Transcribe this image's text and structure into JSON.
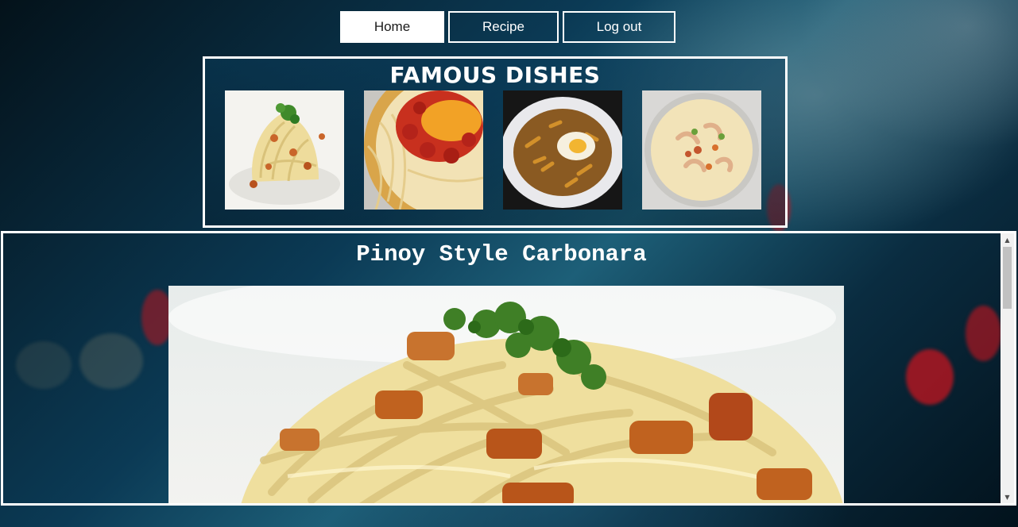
{
  "nav": {
    "home_label": "Home",
    "recipe_label": "Recipe",
    "logout_label": "Log out",
    "active": "Home"
  },
  "famous_dishes": {
    "title": "FAMOUS DISHES",
    "images": [
      "carbonara-image",
      "spaghetti-image",
      "macaroni-egg-image",
      "macaroni-soup-image"
    ]
  },
  "recipe": {
    "title": "Pinoy Style Carbonara",
    "image": "carbonara-image"
  },
  "colors": {
    "border": "#ffffff",
    "background_dark": "#04121a",
    "background_teal": "#1d5f78",
    "scrollbar": "#f1f1f1",
    "scroll_thumb": "#c1c1c1"
  }
}
